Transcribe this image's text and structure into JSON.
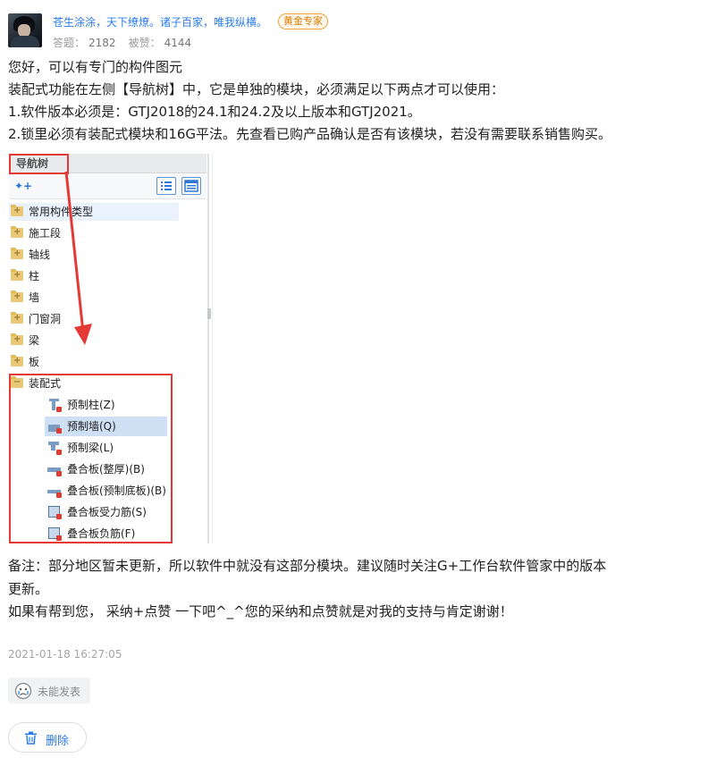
{
  "author": {
    "name": "苍生涂涂，天下缭燎。诸子百家，唯我纵横。",
    "badge": "黄金专家",
    "answers_label": "答题：",
    "answers": "2182",
    "likes_label": "被赞：",
    "likes": "4144"
  },
  "answer": {
    "lines": [
      "您好，可以有专门的构件图元",
      "装配式功能在左侧【导航树】中，它是单独的模块，必须满足以下两点才可以使用：",
      "1.软件版本必须是：GTJ2018的24.1和24.2及以上版本和GTJ2021。",
      "2.锁里必须有装配式模块和16G平法。先查看已购产品确认是否有该模块，若没有需要联系销售购买。"
    ],
    "note_lines": [
      "备注：部分地区暂未更新，所以软件中就没有这部分模块。建议随时关注G+工作台软件管家中的版本",
      "更新。",
      "如果有帮到您，  采纳+点赞 一下吧^_^您的采纳和点赞就是对我的支持与肯定谢谢！"
    ]
  },
  "screenshot": {
    "title": "导航树",
    "tree": [
      {
        "label": "常用构件类型",
        "sign": "+"
      },
      {
        "label": "施工段",
        "sign": "+"
      },
      {
        "label": "轴线",
        "sign": "+"
      },
      {
        "label": "柱",
        "sign": "+"
      },
      {
        "label": "墙",
        "sign": "+"
      },
      {
        "label": "门窗洞",
        "sign": "+"
      },
      {
        "label": "梁",
        "sign": "+"
      },
      {
        "label": "板",
        "sign": "+"
      },
      {
        "label": "装配式",
        "sign": "−"
      }
    ],
    "children": [
      "预制柱(Z)",
      "预制墙(Q)",
      "预制梁(L)",
      "叠合板(整厚)(B)",
      "叠合板(预制底板)(B)",
      "叠合板受力筋(S)",
      "叠合板负筋(F)"
    ]
  },
  "footer": {
    "time": "2021-01-18 16:27:05",
    "unable_label": "未能发表",
    "delete_label": "删除"
  },
  "colors": {
    "link": "#2b7de9",
    "badge": "#d97a00",
    "highlight_box": "#e53935"
  }
}
